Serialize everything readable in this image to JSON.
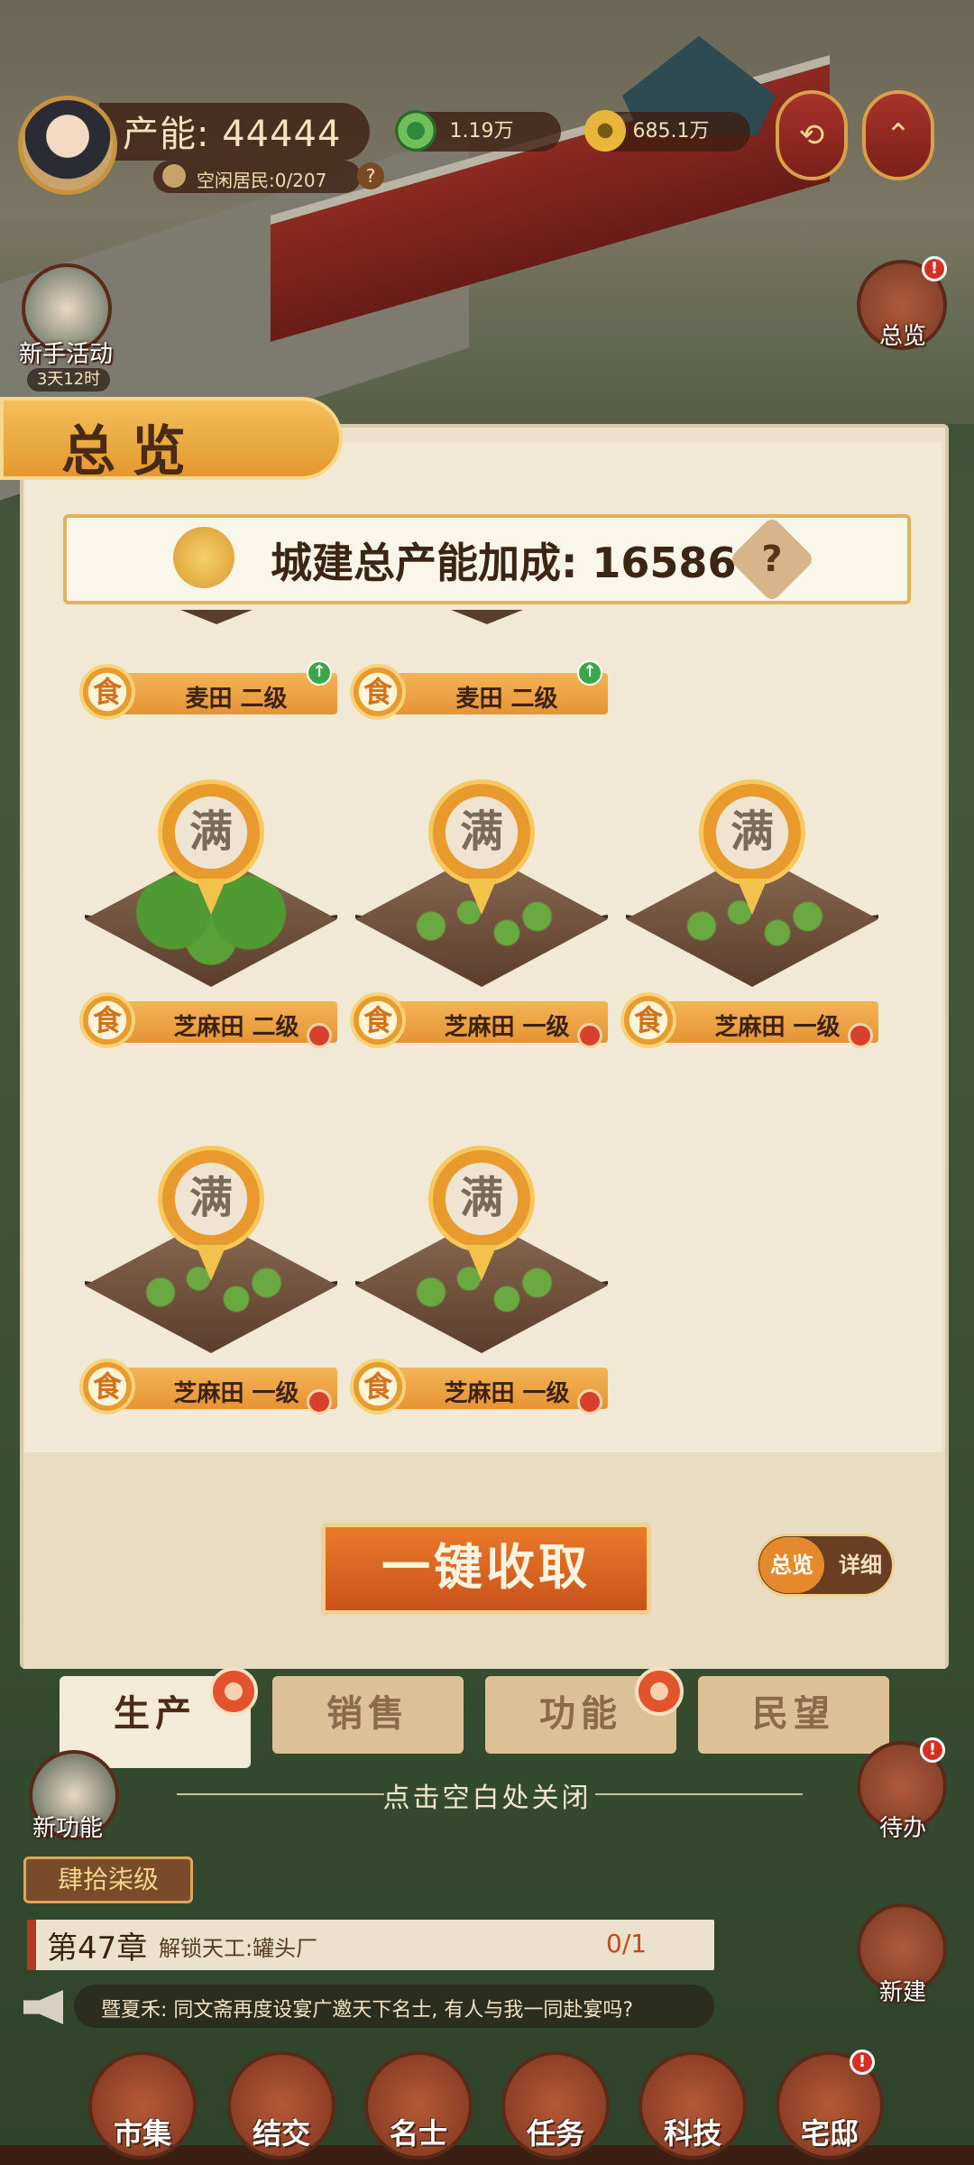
{
  "top": {
    "power_label": "产能: 44444",
    "idle_residents": "空闲居民:0/207",
    "help_glyph": "?",
    "copper": "1.19万",
    "gold": "685.1万",
    "icons": [
      "avatar",
      "resident-icon",
      "copper-coin-icon",
      "gold-coin-icon",
      "share-lantern-icon",
      "expand-lantern-icon"
    ]
  },
  "side": {
    "newbie_event": "新手活动",
    "newbie_timer": "3天12时",
    "overview": "总览",
    "new_feature": "新功能",
    "todo": "待办",
    "build": "新建",
    "badge": "!"
  },
  "panel": {
    "title": "总览",
    "bonus_label": "城建总产能加成: 16586",
    "bonus_help": "?",
    "full_glyph": "满",
    "food_glyph": "食",
    "up_glyph": "↑",
    "row1": [
      {
        "name": "麦田 二级",
        "badge": "upgrade"
      },
      {
        "name": "麦田 二级",
        "badge": "upgrade"
      }
    ],
    "row2": [
      {
        "name": "芝麻田 二级",
        "badge": "alert"
      },
      {
        "name": "芝麻田 一级",
        "badge": "alert"
      },
      {
        "name": "芝麻田 一级",
        "badge": "alert"
      }
    ],
    "row3": [
      {
        "name": "芝麻田 一级",
        "badge": "alert"
      },
      {
        "name": "芝麻田 一级",
        "badge": "alert"
      }
    ],
    "collect_all": "一键收取",
    "toggle_on": "总览",
    "toggle_off": "详细"
  },
  "tabs": [
    "生产",
    "销售",
    "功能",
    "民望"
  ],
  "close_hint": "点击空白处关闭",
  "rank": "肆拾柒级",
  "chapter": {
    "number": "第47章",
    "task": "解锁天工:罐头厂",
    "progress": "0/1"
  },
  "news": "暨夏禾: 同文斋再度设宴广邀天下名士, 有人与我一同赴宴吗?",
  "nav": [
    "市集",
    "结交",
    "名士",
    "任务",
    "科技",
    "宅邸"
  ],
  "colors": {
    "accent": "#e58a2c",
    "panel": "#ece1cb",
    "danger": "#d62f22"
  }
}
